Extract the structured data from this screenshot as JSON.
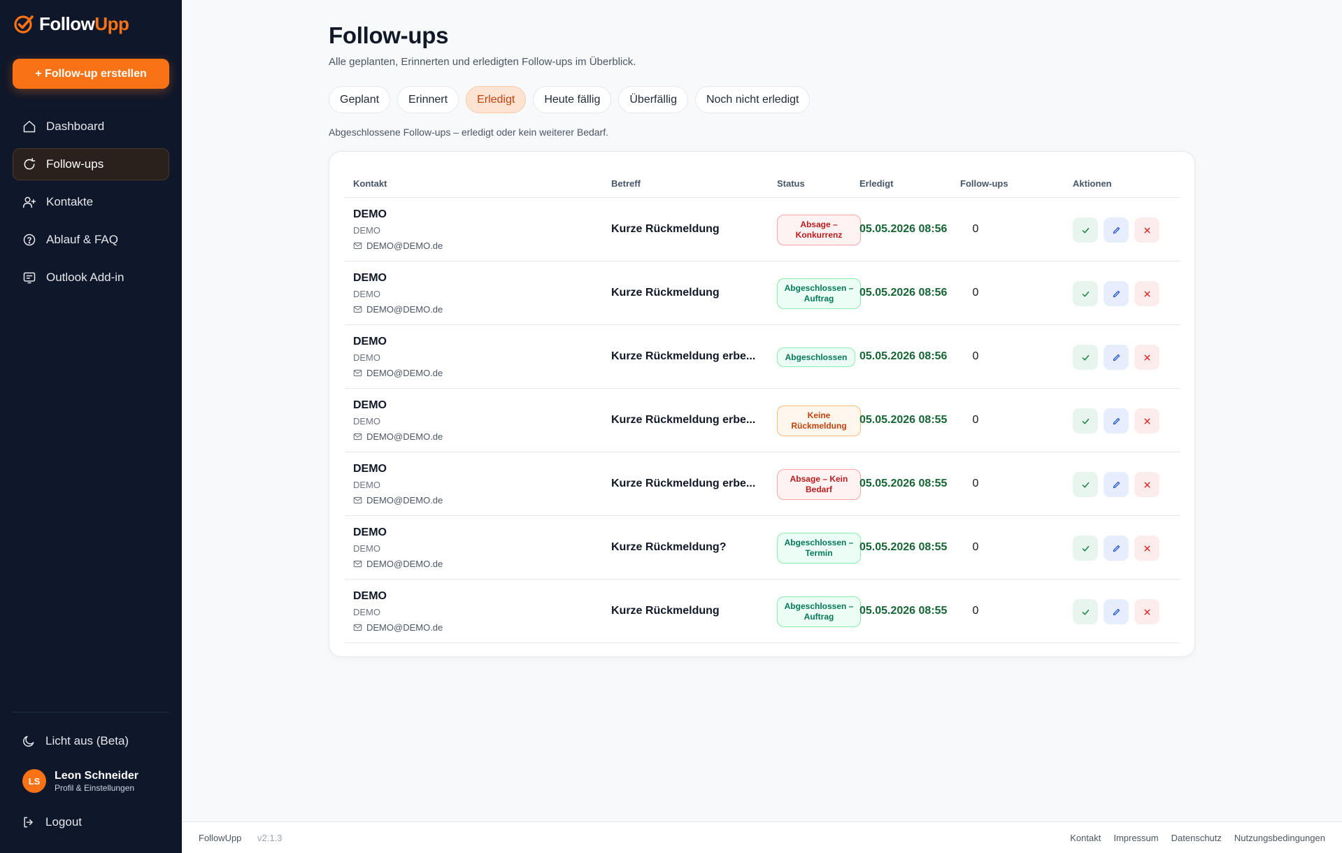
{
  "app": {
    "brand_part1": "Follow",
    "brand_part2": "Upp",
    "accent": "#f97316"
  },
  "sidebar": {
    "create_label": "+ Follow-up erstellen",
    "items": [
      {
        "label": "Dashboard",
        "icon": "home-icon"
      },
      {
        "label": "Follow-ups",
        "icon": "refresh-icon",
        "active": true
      },
      {
        "label": "Kontakte",
        "icon": "user-plus-icon"
      },
      {
        "label": "Ablauf & FAQ",
        "icon": "help-circle-icon"
      },
      {
        "label": "Outlook Add-in",
        "icon": "outlook-icon"
      }
    ],
    "theme_label": "Licht aus (Beta)",
    "user": {
      "initials": "LS",
      "name": "Leon Schneider",
      "subtitle": "Profil & Einstellungen"
    },
    "logout_label": "Logout"
  },
  "main": {
    "title": "Follow-ups",
    "subtitle": "Alle geplanten, Erinnerten und erledigten Follow-ups im Überblick.",
    "tabs": [
      {
        "label": "Geplant"
      },
      {
        "label": "Erinnert"
      },
      {
        "label": "Erledigt",
        "active": true
      },
      {
        "label": "Heute fällig"
      },
      {
        "label": "Überfällig"
      },
      {
        "label": "Noch nicht erledigt"
      }
    ],
    "filter_note": "Abgeschlossene Follow-ups – erledigt oder kein weiterer Bedarf.",
    "table": {
      "headers": [
        "Kontakt",
        "Betreff",
        "Status",
        "Erledigt",
        "Follow-ups",
        "Aktionen"
      ],
      "rows": [
        {
          "name": "DEMO",
          "company": "DEMO",
          "email": "DEMO@DEMO.de",
          "subject": "Kurze Rückmeldung",
          "status": "Absage – Konkurrenz",
          "status_tone": "red",
          "done": "05.05.2026 08:56",
          "count": "0"
        },
        {
          "name": "DEMO",
          "company": "DEMO",
          "email": "DEMO@DEMO.de",
          "subject": "Kurze Rückmeldung",
          "status": "Abgeschlossen – Auftrag",
          "status_tone": "green",
          "done": "05.05.2026 08:56",
          "count": "0"
        },
        {
          "name": "DEMO",
          "company": "DEMO",
          "email": "DEMO@DEMO.de",
          "subject": "Kurze Rückmeldung erbe...",
          "status": "Abgeschlossen",
          "status_tone": "green",
          "done": "05.05.2026 08:56",
          "count": "0"
        },
        {
          "name": "DEMO",
          "company": "DEMO",
          "email": "DEMO@DEMO.de",
          "subject": "Kurze Rückmeldung erbe...",
          "status": "Keine Rückmeldung",
          "status_tone": "orange",
          "done": "05.05.2026 08:55",
          "count": "0"
        },
        {
          "name": "DEMO",
          "company": "DEMO",
          "email": "DEMO@DEMO.de",
          "subject": "Kurze Rückmeldung erbe...",
          "status": "Absage – Kein Bedarf",
          "status_tone": "red",
          "done": "05.05.2026 08:55",
          "count": "0"
        },
        {
          "name": "DEMO",
          "company": "DEMO",
          "email": "DEMO@DEMO.de",
          "subject": "Kurze Rückmeldung?",
          "status": "Abgeschlossen – Termin",
          "status_tone": "green",
          "done": "05.05.2026 08:55",
          "count": "0"
        },
        {
          "name": "DEMO",
          "company": "DEMO",
          "email": "DEMO@DEMO.de",
          "subject": "Kurze Rückmeldung",
          "status": "Abgeschlossen – Auftrag",
          "status_tone": "green",
          "done": "05.05.2026 08:55",
          "count": "0"
        }
      ]
    }
  },
  "footer": {
    "brand": "FollowUpp",
    "version": "v2.1.3",
    "links": [
      "Kontakt",
      "Impressum",
      "Datenschutz",
      "Nutzungsbedingungen"
    ]
  }
}
